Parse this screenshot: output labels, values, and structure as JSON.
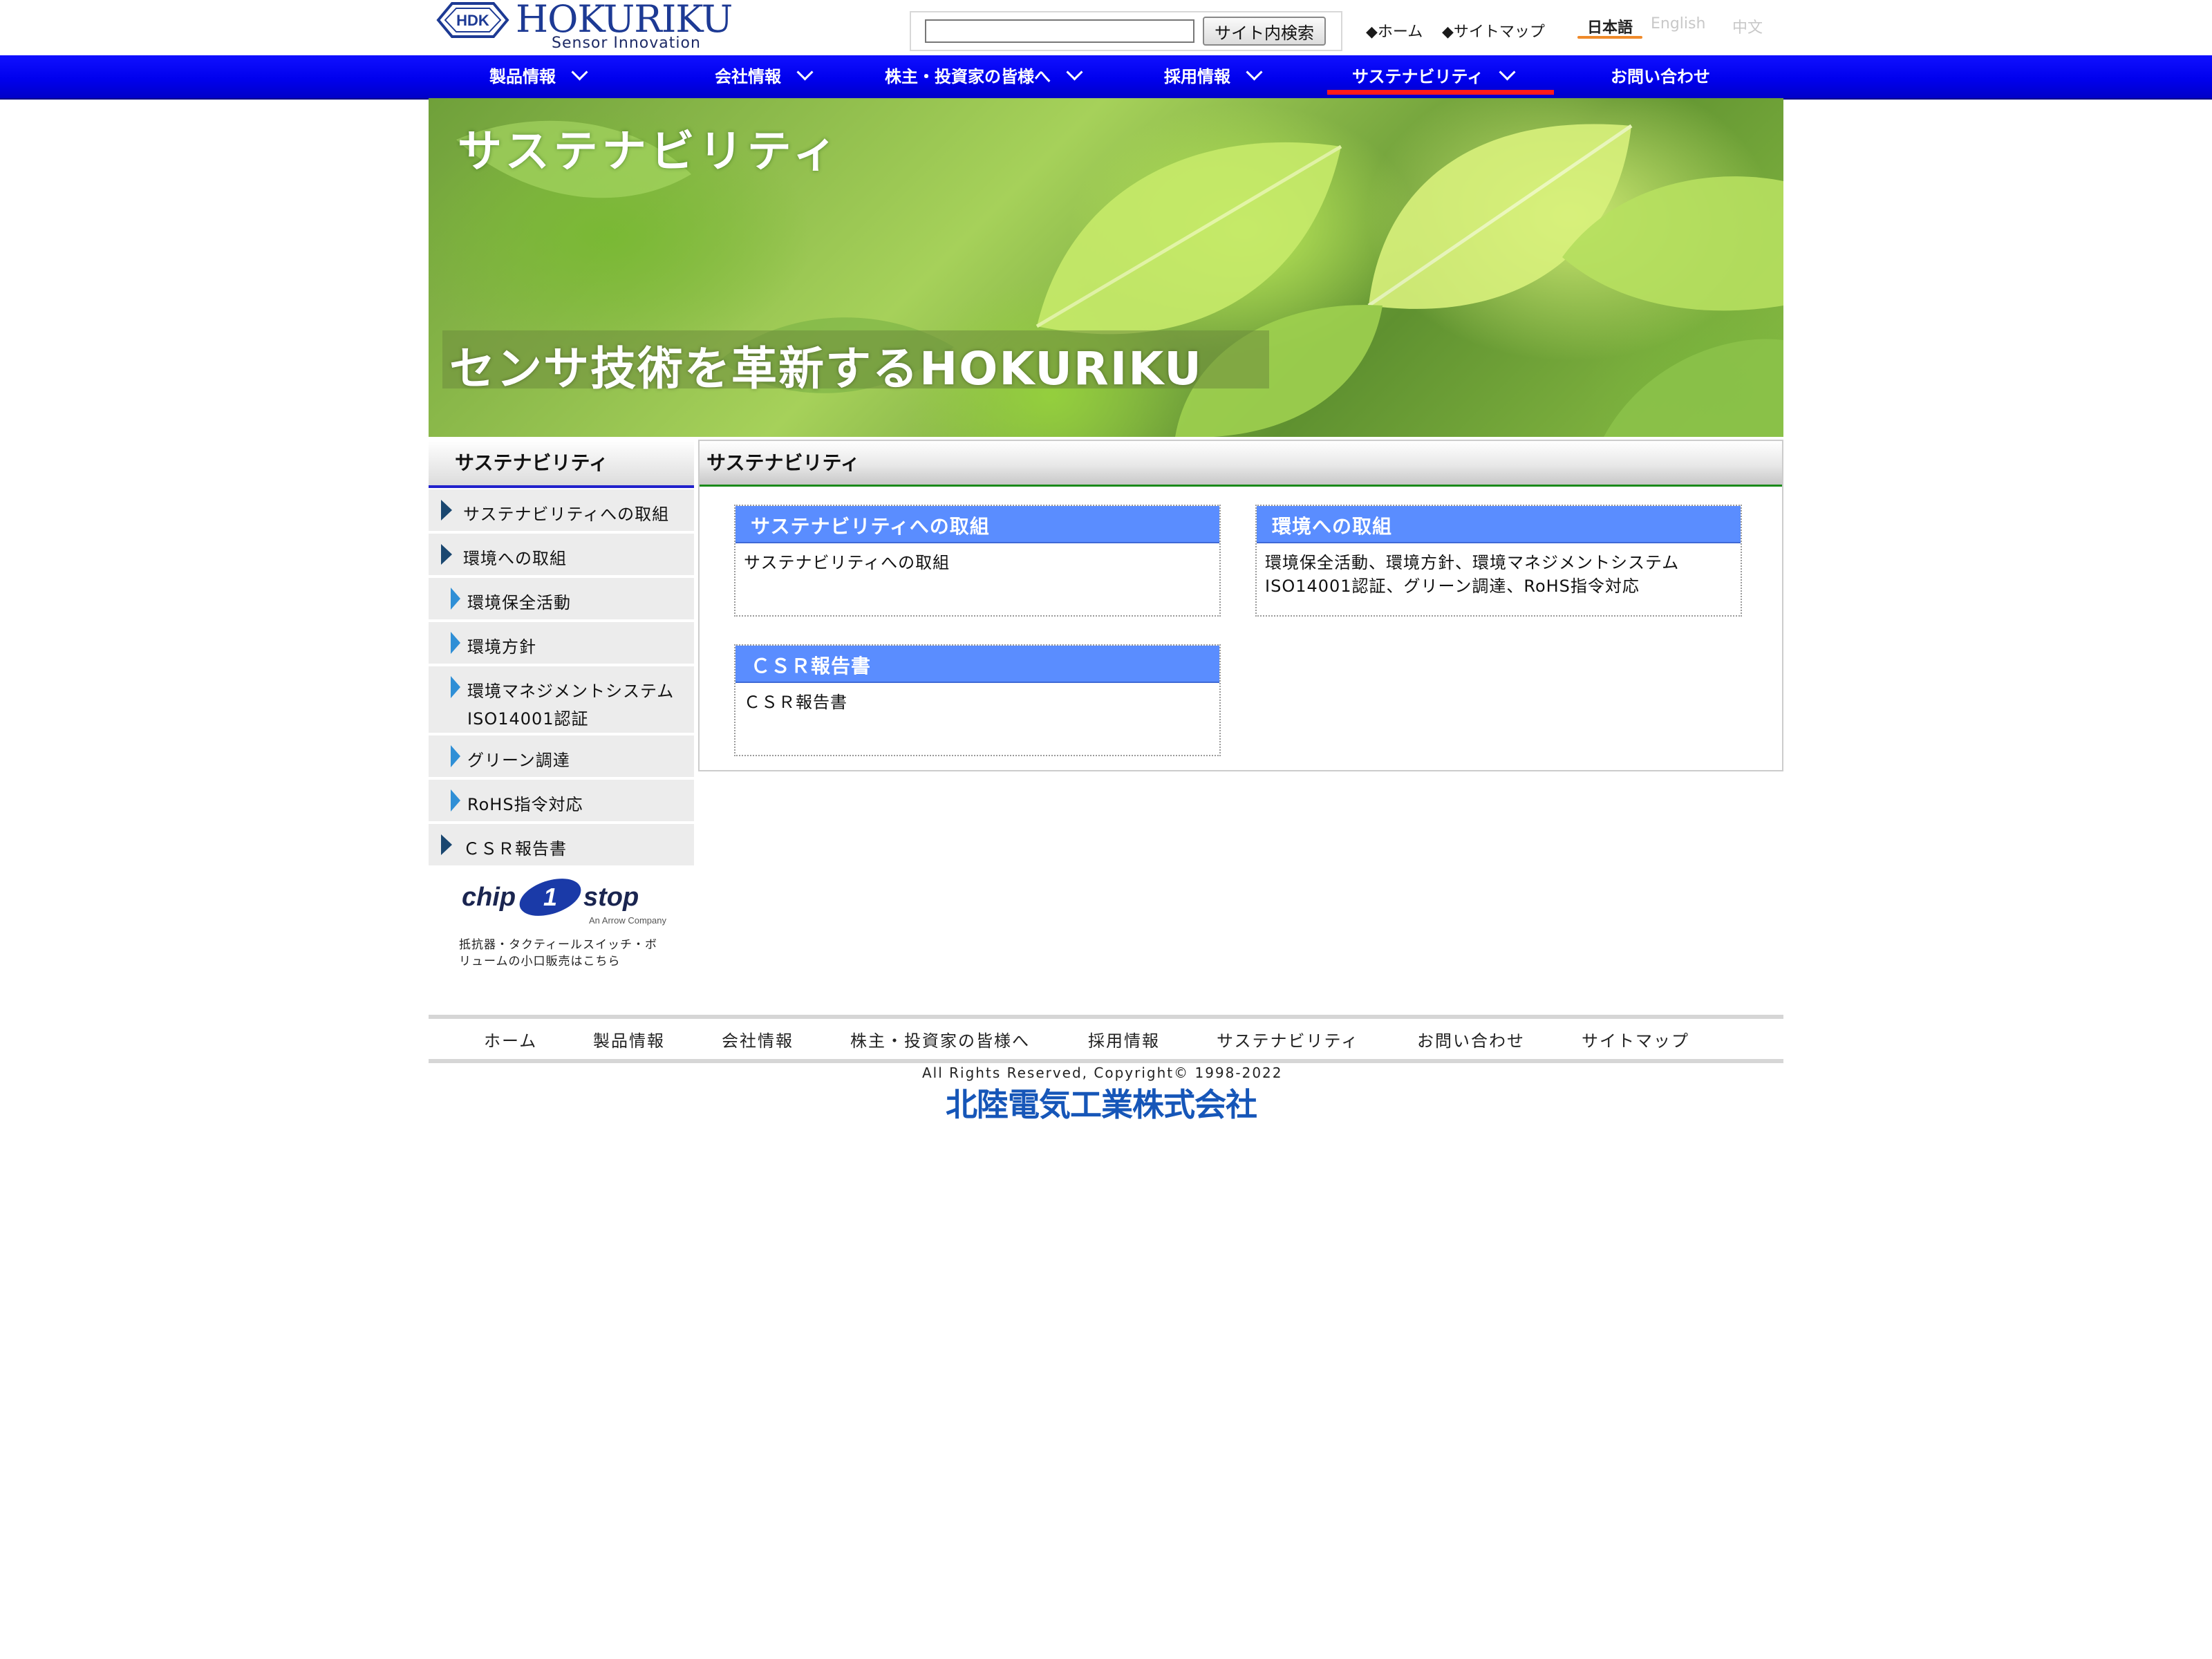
{
  "header": {
    "logo_mark": "HDK",
    "logo_word": "HOKURIKU",
    "logo_tagline": "Sensor Innovation",
    "search_button": "サイト内検索",
    "search_value": "",
    "top_links": [
      "◆ホーム",
      "◆サイトマップ"
    ],
    "languages": {
      "ja": "日本語",
      "en": "English",
      "zh": "中文",
      "active": "ja"
    }
  },
  "global_nav": {
    "items": [
      "製品情報",
      "会社情報",
      "株主・投資家の皆様へ",
      "採用情報",
      "サステナビリティ",
      "お問い合わせ"
    ],
    "active": "サステナビリティ",
    "bar_color": "#0000ee",
    "active_underline_color": "#ff1a1a"
  },
  "hero": {
    "title": "サステナビリティ",
    "tagline": "センサ技術を革新するHOKURIKU"
  },
  "sidebar": {
    "heading": "サステナビリティ",
    "items": [
      {
        "label": "サステナビリティへの取組",
        "level": 1
      },
      {
        "label": "環境への取組",
        "level": 1
      },
      {
        "label": "環境保全活動",
        "level": 2
      },
      {
        "label": "環境方針",
        "level": 2
      },
      {
        "label": "環境マネジメントシステム",
        "label2": "ISO14001認証",
        "level": 2
      },
      {
        "label": "グリーン調達",
        "level": 2
      },
      {
        "label": "RoHS指令対応",
        "level": 2
      },
      {
        "label": "ＣＳＲ報告書",
        "level": 1
      }
    ],
    "banner": {
      "logo_text": "chip 1 stop",
      "logo_sub": "An Arrow Company",
      "caption_line1": "抵抗器・タクティールスイッチ・ボ",
      "caption_line2": "リュームの小口販売はこちら"
    }
  },
  "main": {
    "heading": "サステナビリティ",
    "cards": [
      {
        "title": "サステナビリティへの取組",
        "body": [
          "サステナビリティへの取組"
        ]
      },
      {
        "title": "環境への取組",
        "body": [
          "環境保全活動、環境方針、環境マネジメントシステム",
          "ISO14001認証、グリーン調達、RoHS指令対応"
        ]
      },
      {
        "title": "ＣＳＲ報告書",
        "body": [
          "ＣＳＲ報告書"
        ]
      }
    ],
    "card_header_color": "#5a8dff"
  },
  "footer": {
    "links": [
      "ホーム",
      "製品情報",
      "会社情報",
      "株主・投資家の皆様へ",
      "採用情報",
      "サステナビリティ",
      "お問い合わせ",
      "サイトマップ"
    ],
    "copyright": "All Rights Reserved, Copyright© 1998-2022",
    "company": "北陸電気工業株式会社"
  }
}
